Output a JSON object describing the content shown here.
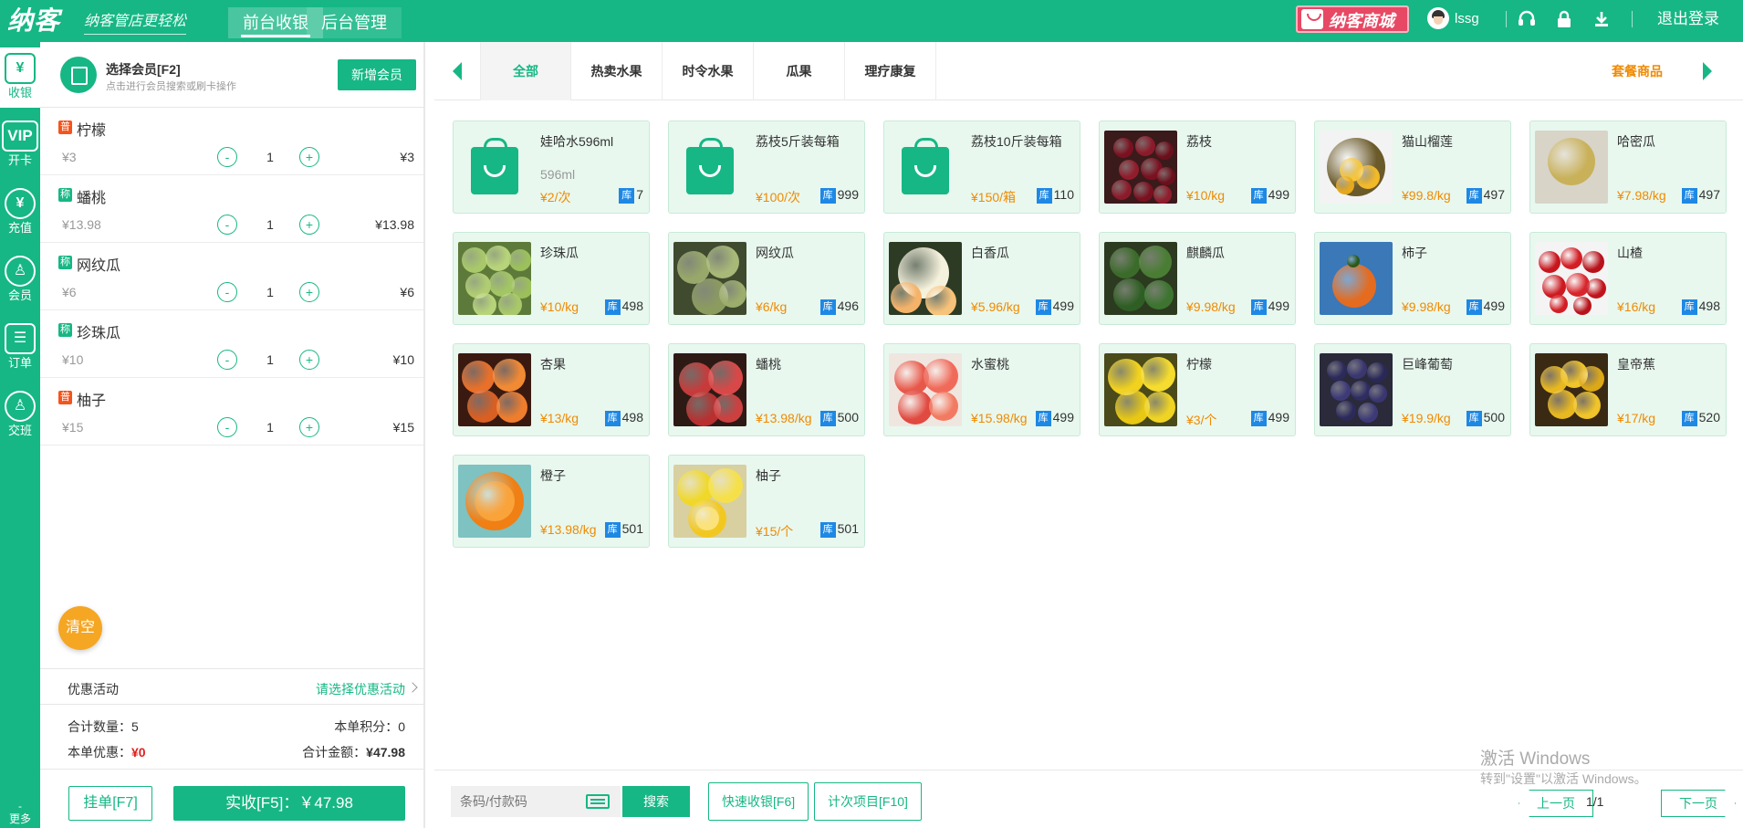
{
  "header": {
    "logo": "纳客",
    "slogan": "纳客管店更轻松",
    "tabs": [
      {
        "label": "前台收银",
        "active": true
      },
      {
        "label": "后台管理",
        "active": false
      }
    ],
    "mall_label": "纳客商城",
    "username": "lssg",
    "icons": [
      "headset-icon",
      "lock-icon",
      "download-icon"
    ],
    "logout_label": "退出登录",
    "brand_color": "#16b784"
  },
  "sidebar": {
    "items": [
      {
        "icon": "¥",
        "label": "收银",
        "active": true
      },
      {
        "icon": "VIP",
        "label": "开卡",
        "active": false
      },
      {
        "icon": "¥",
        "label": "充值",
        "active": false
      },
      {
        "icon": "♙",
        "label": "会员",
        "active": false
      },
      {
        "icon": "☰",
        "label": "订单",
        "active": false
      },
      {
        "icon": "♙",
        "label": "交班",
        "active": false
      }
    ],
    "more_label": "更多"
  },
  "member": {
    "title": "选择会员[F2]",
    "subtitle": "点击进行会员搜索或刷卡操作",
    "add_button": "新增会员"
  },
  "cart": {
    "items": [
      {
        "tag": "普",
        "tag_color": "#f5541c",
        "name": "柠檬",
        "unit_price": "¥3",
        "qty": "1",
        "subtotal": "¥3"
      },
      {
        "tag": "称",
        "tag_color": "#16b784",
        "name": "蟠桃",
        "unit_price": "¥13.98",
        "qty": "1",
        "subtotal": "¥13.98"
      },
      {
        "tag": "称",
        "tag_color": "#16b784",
        "name": "网纹瓜",
        "unit_price": "¥6",
        "qty": "1",
        "subtotal": "¥6"
      },
      {
        "tag": "称",
        "tag_color": "#16b784",
        "name": "珍珠瓜",
        "unit_price": "¥10",
        "qty": "1",
        "subtotal": "¥10"
      },
      {
        "tag": "普",
        "tag_color": "#f5541c",
        "name": "柚子",
        "unit_price": "¥15",
        "qty": "1",
        "subtotal": "¥15"
      }
    ],
    "minus_label": "-",
    "plus_label": "+",
    "clear_label": "清空",
    "promo_label": "优惠活动",
    "promo_link": "请选择优惠活动",
    "total_qty_label": "合计数量：",
    "total_qty": "5",
    "points_label": "本单积分：",
    "points": "0",
    "discount_label": "本单优惠：",
    "discount": "¥0",
    "total_label": "合计金额：",
    "total": "¥47.98",
    "hold_button": "挂单[F7]",
    "pay_button": "实收[F5]：￥47.98"
  },
  "categories": {
    "tabs": [
      {
        "label": "全部",
        "active": true
      },
      {
        "label": "热卖水果",
        "active": false
      },
      {
        "label": "时令水果",
        "active": false
      },
      {
        "label": "瓜果",
        "active": false
      },
      {
        "label": "理疗康复",
        "active": false
      }
    ],
    "combo_label": "套餐商品"
  },
  "products": [
    {
      "name": "娃哈水596ml",
      "spec": "596ml",
      "price": "¥2/次",
      "stock": "7",
      "img": "bag"
    },
    {
      "name": "荔枝5斤装每箱",
      "spec": "",
      "price": "¥100/次",
      "stock": "999",
      "img": "bag"
    },
    {
      "name": "荔枝10斤装每箱",
      "spec": "",
      "price": "¥150/箱",
      "stock": "110",
      "img": "bag"
    },
    {
      "name": "荔枝",
      "spec": "",
      "price": "¥10/kg",
      "stock": "499",
      "img": "lychee"
    },
    {
      "name": "猫山榴莲",
      "spec": "",
      "price": "¥99.8/kg",
      "stock": "497",
      "img": "durian"
    },
    {
      "name": "哈密瓜",
      "spec": "",
      "price": "¥7.98/kg",
      "stock": "497",
      "img": "hami"
    },
    {
      "name": "珍珠瓜",
      "spec": "",
      "price": "¥10/kg",
      "stock": "498",
      "img": "pearl"
    },
    {
      "name": "网纹瓜",
      "spec": "",
      "price": "¥6/kg",
      "stock": "496",
      "img": "net"
    },
    {
      "name": "白香瓜",
      "spec": "",
      "price": "¥5.96/kg",
      "stock": "499",
      "img": "whitemelon"
    },
    {
      "name": "麒麟瓜",
      "spec": "",
      "price": "¥9.98/kg",
      "stock": "499",
      "img": "watermelon"
    },
    {
      "name": "柿子",
      "spec": "",
      "price": "¥9.98/kg",
      "stock": "499",
      "img": "persimmon"
    },
    {
      "name": "山楂",
      "spec": "",
      "price": "¥16/kg",
      "stock": "498",
      "img": "hawthorn"
    },
    {
      "name": "杏果",
      "spec": "",
      "price": "¥13/kg",
      "stock": "498",
      "img": "apricot"
    },
    {
      "name": "蟠桃",
      "spec": "",
      "price": "¥13.98/kg",
      "stock": "500",
      "img": "flatpeach"
    },
    {
      "name": "水蜜桃",
      "spec": "",
      "price": "¥15.98/kg",
      "stock": "499",
      "img": "peach"
    },
    {
      "name": "柠檬",
      "spec": "",
      "price": "¥3/个",
      "stock": "499",
      "img": "lemon"
    },
    {
      "name": "巨峰葡萄",
      "spec": "",
      "price": "¥19.9/kg",
      "stock": "500",
      "img": "grape"
    },
    {
      "name": "皇帝蕉",
      "spec": "",
      "price": "¥17/kg",
      "stock": "520",
      "img": "banana"
    },
    {
      "name": "橙子",
      "spec": "",
      "price": "¥13.98/kg",
      "stock": "501",
      "img": "orange"
    },
    {
      "name": "柚子",
      "spec": "",
      "price": "¥15/个",
      "stock": "501",
      "img": "pomelo"
    }
  ],
  "stock_badge": "库",
  "bottom": {
    "barcode_placeholder": "条码/付款码",
    "search_button": "搜索",
    "quick_button": "快速收银[F6]",
    "count_button": "计次项目[F10]",
    "prev_label": "上一页",
    "page_label": "1/1",
    "next_label": "下一页"
  },
  "watermark": {
    "line1": "激活 Windows",
    "line2": "转到\"设置\"以激活 Windows。"
  }
}
